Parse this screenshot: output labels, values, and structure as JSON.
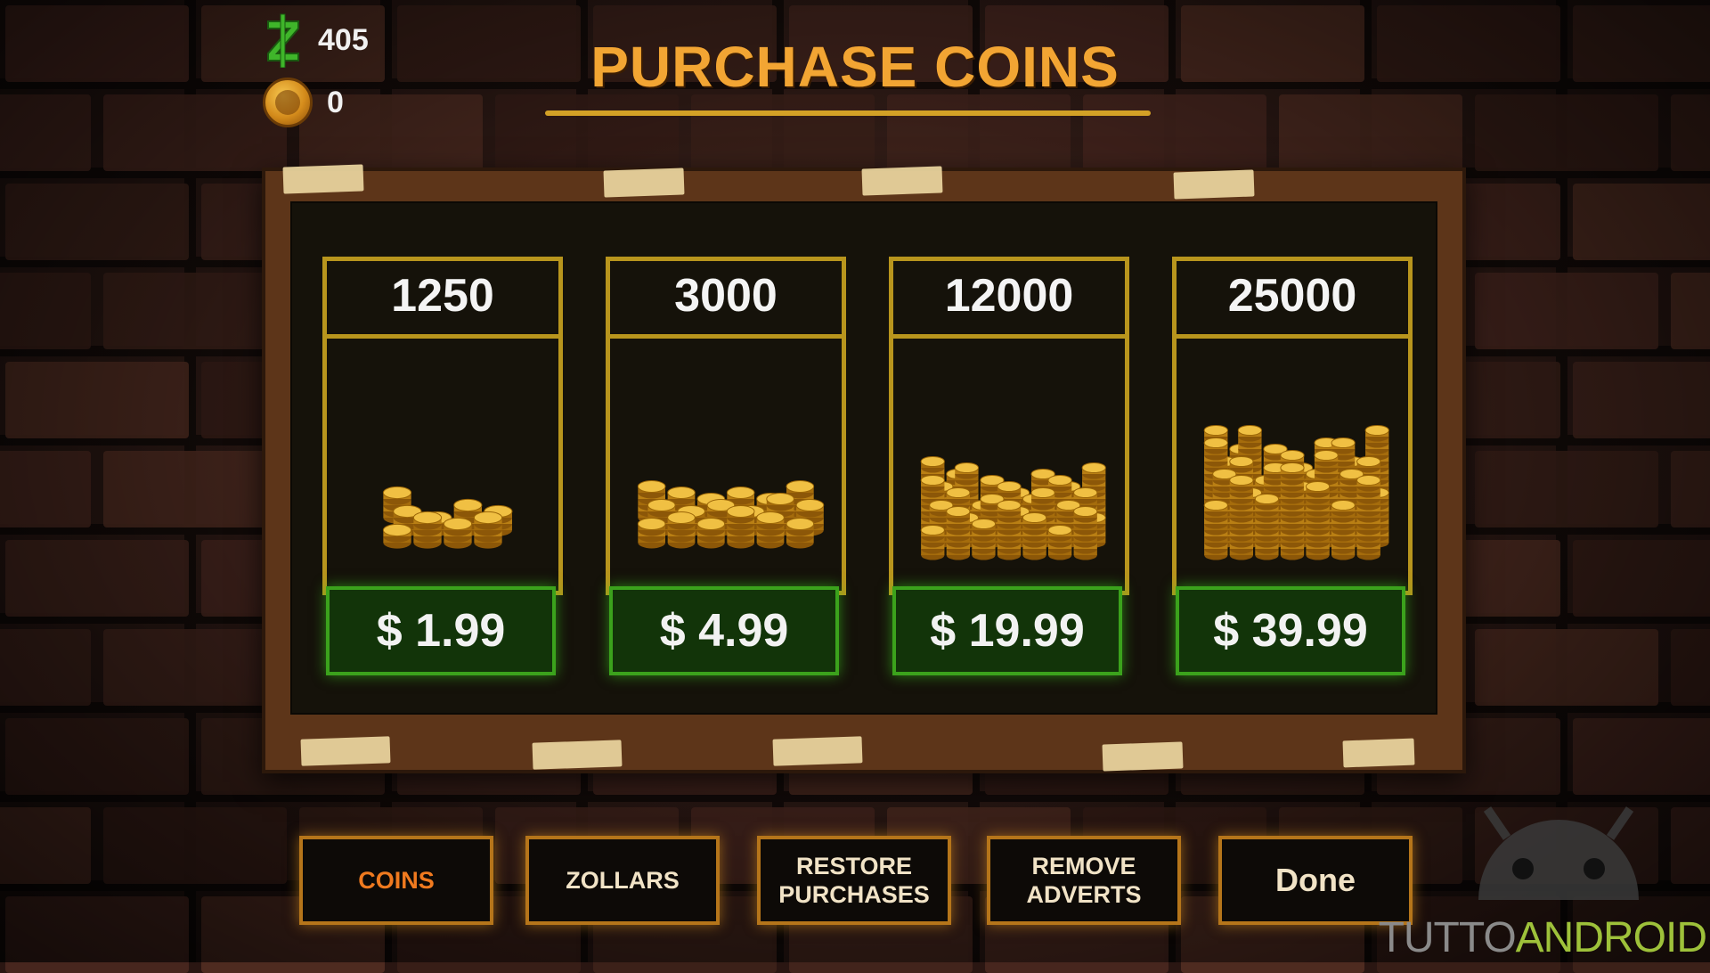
{
  "hud": {
    "zollars_value": "405",
    "coins_value": "0",
    "zollars_icon": "zollar-z-icon",
    "coins_icon": "gold-coin-icon"
  },
  "title": "PURCHASE COINS",
  "offers": [
    {
      "amount": "1250",
      "price": "$ 1.99",
      "image": "small-coin-pile"
    },
    {
      "amount": "3000",
      "price": "$ 4.99",
      "image": "medium-coin-pile"
    },
    {
      "amount": "12000",
      "price": "$ 19.99",
      "image": "large-coin-pile"
    },
    {
      "amount": "25000",
      "price": "$ 39.99",
      "image": "huge-coin-pile"
    }
  ],
  "nav": [
    {
      "label": "COINS",
      "active": true
    },
    {
      "label": "ZOLLARS",
      "active": false
    },
    {
      "label": "RESTORE\nPURCHASES",
      "active": false
    },
    {
      "label": "REMOVE\nADVERTS",
      "active": false
    },
    {
      "label": "Done",
      "active": false
    }
  ],
  "watermark": {
    "part1": "TUTTO",
    "part2": "ANDROID"
  },
  "colors": {
    "title": "#f2a533",
    "price_border": "#3ba21c",
    "nav_border": "#b5751a",
    "active_nav": "#f07a1f",
    "frame_gold": "#b8951d"
  }
}
